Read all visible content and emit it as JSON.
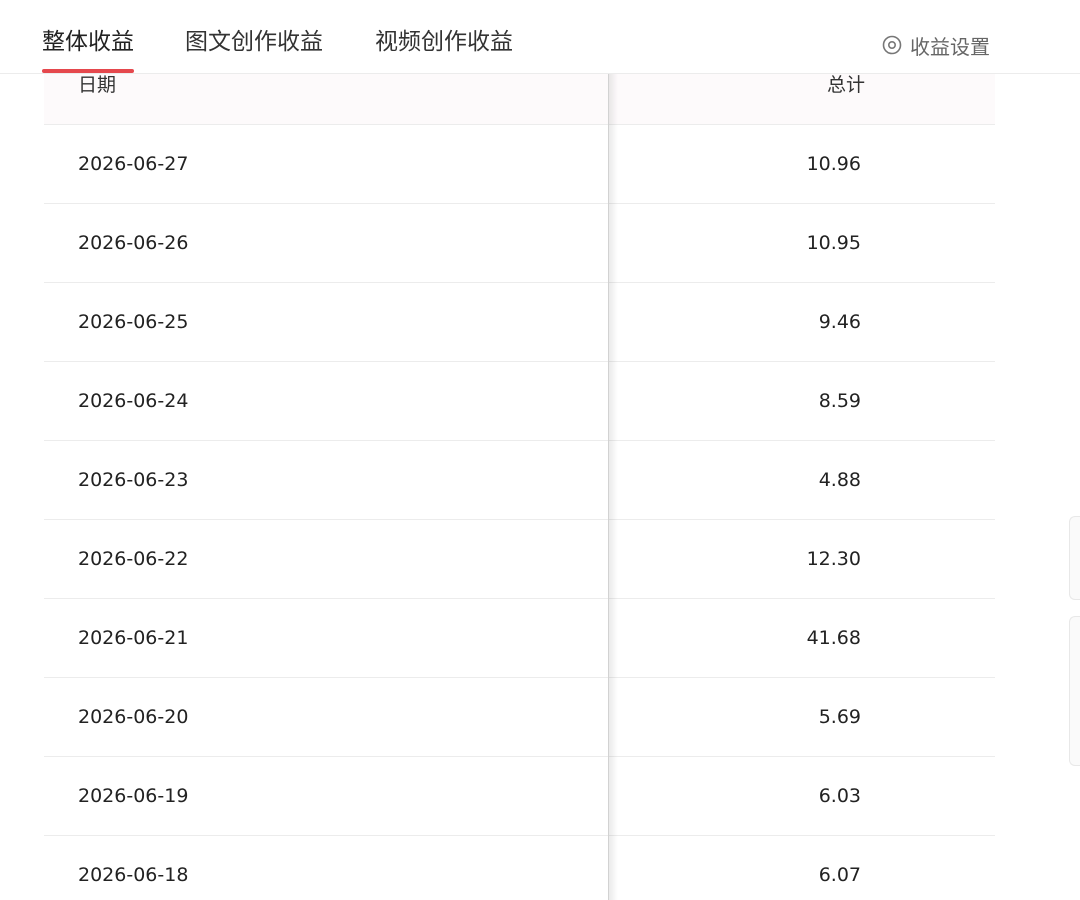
{
  "tabs": [
    {
      "label": "整体收益",
      "active": true
    },
    {
      "label": "图文创作收益",
      "active": false
    },
    {
      "label": "视频创作收益",
      "active": false
    }
  ],
  "settings": {
    "label": "收益设置",
    "icon": "settings-circle-icon"
  },
  "table": {
    "headers": {
      "date": "日期",
      "total": "总计"
    },
    "rows": [
      {
        "date": "2026-06-27",
        "total": "10.96"
      },
      {
        "date": "2026-06-26",
        "total": "10.95"
      },
      {
        "date": "2026-06-25",
        "total": "9.46"
      },
      {
        "date": "2026-06-24",
        "total": "8.59"
      },
      {
        "date": "2026-06-23",
        "total": "4.88"
      },
      {
        "date": "2026-06-22",
        "total": "12.30"
      },
      {
        "date": "2026-06-21",
        "total": "41.68"
      },
      {
        "date": "2026-06-20",
        "total": "5.69"
      },
      {
        "date": "2026-06-19",
        "total": "6.03"
      },
      {
        "date": "2026-06-18",
        "total": "6.07"
      }
    ]
  },
  "colors": {
    "accent": "#e5484d",
    "header_bg": "#fdfafb",
    "border": "#ececec"
  }
}
